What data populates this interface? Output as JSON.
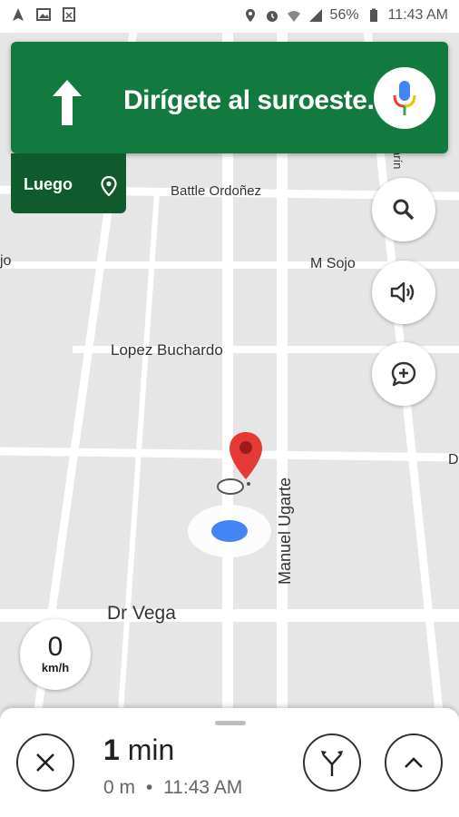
{
  "status_bar": {
    "battery": "56%",
    "time": "11:43 AM",
    "left_icons": [
      "navigation-icon",
      "image-icon",
      "app-icon"
    ],
    "right_icons": [
      "location-icon",
      "alarm-icon",
      "wifi-icon",
      "signal-icon",
      "battery-icon"
    ]
  },
  "navigation": {
    "instruction": "Dirígete al suroeste.",
    "then_label": "Luego"
  },
  "map": {
    "streets": {
      "battle": "Battle Ordoñez",
      "sojo_left": "jo",
      "m_sojo": "M Sojo",
      "lopez": "Lopez Buchardo",
      "ugarte": "Manuel Ugarte",
      "vega": "Dr Vega",
      "right_d": "D",
      "top_right": "arín"
    }
  },
  "speed": {
    "value": "0",
    "unit": "km/h"
  },
  "trip": {
    "duration_value": "1",
    "duration_unit": "min",
    "distance": "0 m",
    "separator": "•",
    "arrival": "11:43 AM"
  },
  "colors": {
    "nav_green": "#137a3f",
    "then_green": "#0f5b2e",
    "pin_red": "#e53935",
    "location_blue": "#4285f4"
  }
}
